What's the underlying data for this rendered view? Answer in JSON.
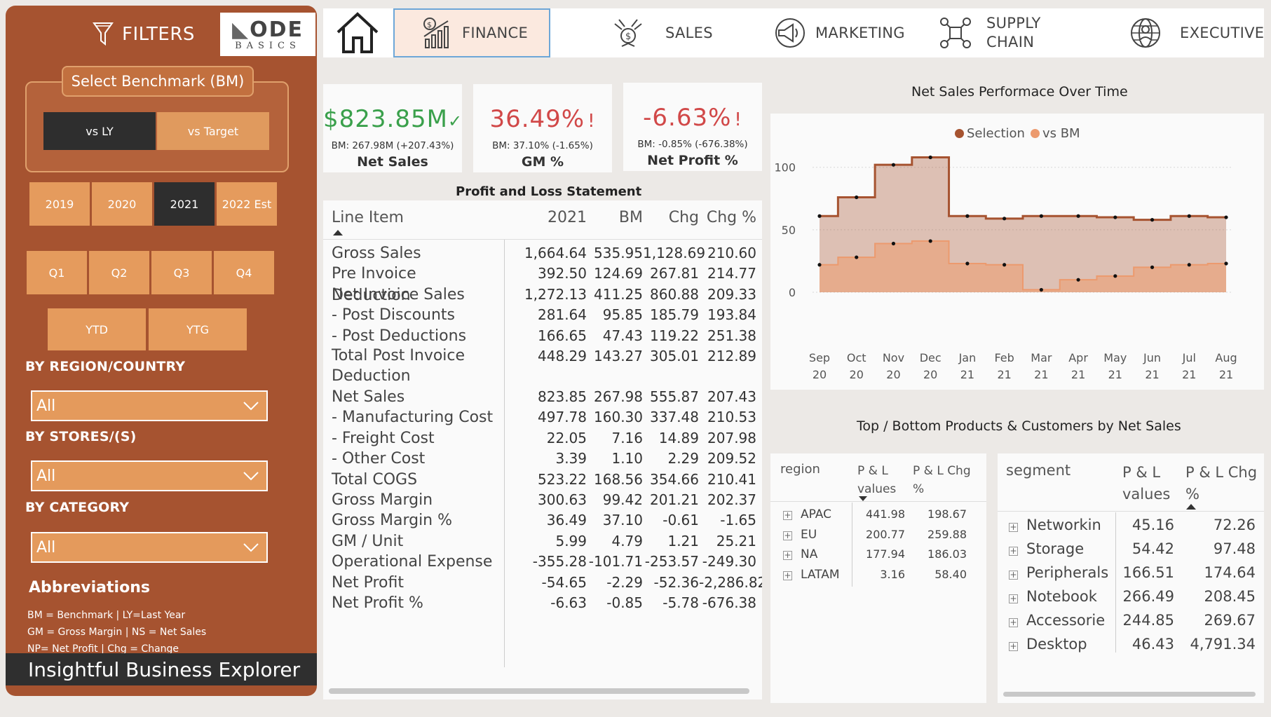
{
  "sidebar": {
    "filters_label": "FILTERS",
    "logo_line1": "ODE",
    "logo_line2": "BASICS",
    "benchmark_title": "Select Benchmark (BM)",
    "benchmark_options": [
      "vs LY",
      "vs Target"
    ],
    "benchmark_selected": "vs LY",
    "years": [
      "2019",
      "2020",
      "2021",
      "2022 Est"
    ],
    "year_selected": "2021",
    "quarters": [
      "Q1",
      "Q2",
      "Q3",
      "Q4"
    ],
    "periods": [
      "YTD",
      "YTG"
    ],
    "region_label": "BY REGION/COUNTRY",
    "region_value": "All",
    "stores_label": "BY STORES/(S)",
    "stores_value": "All",
    "category_label": "BY CATEGORY",
    "category_value": "All",
    "abbr_title": "Abbreviations",
    "abbr_lines": [
      "BM = Benchmark | LY=Last Year",
      "GM = Gross Margin | NS = Net Sales",
      "NP= Net Profit | Chg = Change"
    ],
    "footer": "Insightful Business Explorer"
  },
  "nav": {
    "home_icon": "home-icon",
    "items": [
      {
        "label": "FINANCE",
        "icon": "finance-chart-icon",
        "active": true
      },
      {
        "label": "SALES",
        "icon": "sales-money-icon",
        "active": false
      },
      {
        "label": "MARKETING",
        "icon": "marketing-megaphone-icon",
        "active": false
      },
      {
        "label": "SUPPLY",
        "label2": "CHAIN",
        "icon": "supply-chain-icon",
        "active": false
      },
      {
        "label": "EXECUTIVE",
        "icon": "executive-globe-icon",
        "active": false
      }
    ]
  },
  "kpis": [
    {
      "value": "$823.85M",
      "mark": "✓",
      "sub": "BM: 267.98M (+207.43%)",
      "label": "Net Sales",
      "color": "#3aa04b"
    },
    {
      "value": "36.49%",
      "mark": "!",
      "sub": "BM: 37.10% (-1.65%)",
      "label": "GM %",
      "color": "#d14848"
    },
    {
      "value": "-6.63%",
      "mark": "!",
      "sub": "BM: -0.85% (-676.38%)",
      "label": "Net Profit %",
      "color": "#d14848"
    }
  ],
  "pl": {
    "title": "Profit and Loss Statement",
    "headers": [
      "Line Item",
      "2021",
      "BM",
      "Chg",
      "Chg %"
    ],
    "rows": [
      [
        "Gross Sales",
        "1,664.64",
        "535.95",
        "1,128.69",
        "210.60"
      ],
      [
        "Pre Invoice Deduction",
        "392.50",
        "124.69",
        "267.81",
        "214.77"
      ],
      [
        "Net Invoice Sales",
        "1,272.13",
        "411.25",
        "860.88",
        "209.33"
      ],
      [
        "- Post Discounts",
        "281.64",
        "95.85",
        "185.79",
        "193.84"
      ],
      [
        "- Post Deductions",
        "166.65",
        "47.43",
        "119.22",
        "251.38"
      ],
      [
        "Total Post Invoice Deduction",
        "448.29",
        "143.27",
        "305.01",
        "212.89"
      ],
      [
        "Net Sales",
        "823.85",
        "267.98",
        "555.87",
        "207.43"
      ],
      [
        "- Manufacturing Cost",
        "497.78",
        "160.30",
        "337.48",
        "210.53"
      ],
      [
        "- Freight Cost",
        "22.05",
        "7.16",
        "14.89",
        "207.98"
      ],
      [
        "- Other Cost",
        "3.39",
        "1.10",
        "2.29",
        "209.52"
      ],
      [
        "Total COGS",
        "523.22",
        "168.56",
        "354.66",
        "210.41"
      ],
      [
        "Gross Margin",
        "300.63",
        "99.42",
        "201.21",
        "202.37"
      ],
      [
        "Gross Margin %",
        "36.49",
        "37.10",
        "-0.61",
        "-1.65"
      ],
      [
        "GM / Unit",
        "5.99",
        "4.79",
        "1.21",
        "25.21"
      ],
      [
        "Operational Expense",
        "-355.28",
        "-101.71",
        "-253.57",
        "-249.30"
      ],
      [
        "Net Profit",
        "-54.65",
        "-2.29",
        "-52.36",
        "-2,286.82"
      ],
      [
        "Net Profit %",
        "-6.63",
        "-0.85",
        "-5.78",
        "-676.38"
      ]
    ]
  },
  "chart_data": {
    "type": "area",
    "title": "Net Sales Performace Over Time",
    "legend": [
      "Selection",
      "vs BM"
    ],
    "legend_position": "top-center",
    "x": [
      "Sep 20",
      "Oct 20",
      "Nov 20",
      "Dec 20",
      "Jan 21",
      "Feb 21",
      "Mar 21",
      "Apr 21",
      "May 21",
      "Jun 21",
      "Jul 21",
      "Aug 21"
    ],
    "series": [
      {
        "name": "Selection",
        "values": [
          61,
          76,
          102,
          108,
          61,
          59,
          61,
          61,
          60,
          58,
          61,
          60
        ],
        "color": "#a65330"
      },
      {
        "name": "vs BM",
        "values": [
          22,
          28,
          39,
          41,
          23,
          22,
          2,
          10,
          13,
          20,
          22,
          23
        ],
        "color": "#ec9a6e"
      }
    ],
    "yticks": [
      0,
      50,
      100
    ],
    "ylim": [
      0,
      115
    ],
    "step": true
  },
  "topbottom": {
    "title": "Top / Bottom Products & Customers by Net Sales",
    "region": {
      "headers": [
        "region",
        "P & L",
        "values",
        "P & L Chg",
        "%"
      ],
      "rows": [
        [
          "APAC",
          "441.98",
          "198.67"
        ],
        [
          "EU",
          "200.77",
          "259.88"
        ],
        [
          "NA",
          "177.94",
          "186.03"
        ],
        [
          "LATAM",
          "3.16",
          "58.40"
        ]
      ]
    },
    "segment": {
      "headers": [
        "segment",
        "P & L",
        "values",
        "P & L Chg",
        "%"
      ],
      "rows": [
        [
          "Networkin",
          "45.16",
          "72.26"
        ],
        [
          "Storage",
          "54.42",
          "97.48"
        ],
        [
          "Peripherals",
          "166.51",
          "174.64"
        ],
        [
          "Notebook",
          "266.49",
          "208.45"
        ],
        [
          "Accessorie",
          "244.85",
          "269.67"
        ],
        [
          "Desktop",
          "46.43",
          "4,791.34"
        ]
      ]
    }
  }
}
